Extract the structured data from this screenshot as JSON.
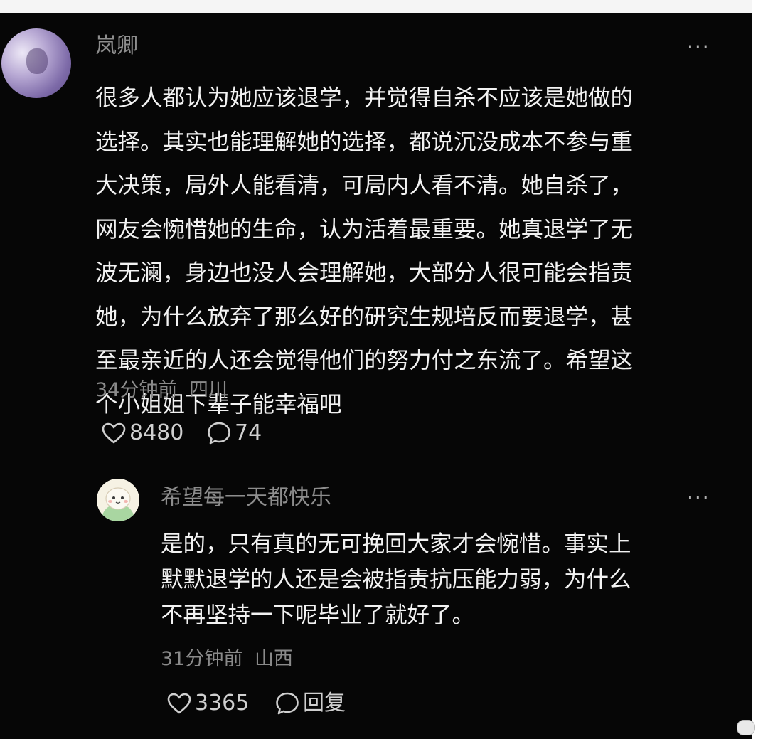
{
  "comment": {
    "username": "岚卿",
    "text": "很多人都认为她应该退学，并觉得自杀不应该是她做的\n选择。其实也能理解她的选择，都说沉没成本不参与重\n大决策，局外人能看清，可局内人看不清。她自杀了，\n网友会惋惜她的生命，认为活着最重要。她真退学了无\n波无澜，身边也没人会理解她，大部分人很可能会指责\n她，为什么放弃了那么好的研究生规培反而要退学，甚\n至最亲近的人还会觉得他们的努力付之东流了。希望这\n个小姐姐下辈子能幸福吧",
    "time": "34分钟前",
    "location": "四川",
    "likes": "8480",
    "replies": "74",
    "more": "···"
  },
  "reply": {
    "username": "希望每一天都快乐",
    "text": "是的，只有真的无可挽回大家才会惋惜。事实上\n默默退学的人还是会被指责抗压能力弱，为什么\n不再坚持一下呢毕业了就好了。",
    "time": "31分钟前",
    "location": "山西",
    "likes": "3365",
    "reply_label": "回复",
    "more": "···"
  },
  "icons": {
    "like": "heart-outline-icon",
    "comment": "speech-bubble-icon",
    "more": "ellipsis-icon"
  },
  "colors": {
    "background": "#060606",
    "text": "#f2f2f2",
    "secondary": "#8d8d8d"
  }
}
